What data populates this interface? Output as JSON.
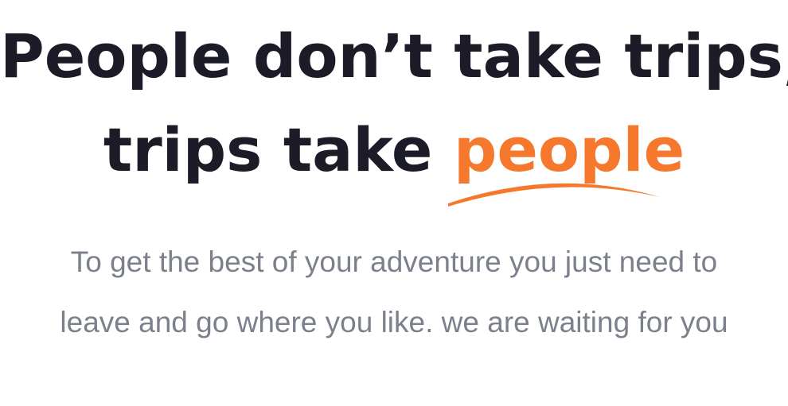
{
  "hero": {
    "headline_line1": "People don’t take trips,",
    "headline_line2_prefix": "trips take ",
    "headline_line2_accent": "people",
    "subtitle": "To get the best of your adventure you just need to leave and go where you like. we are waiting for you"
  },
  "colors": {
    "headline": "#1b1c28",
    "accent": "#f5782c",
    "subtitle": "#7b808c",
    "background": "#ffffff"
  }
}
